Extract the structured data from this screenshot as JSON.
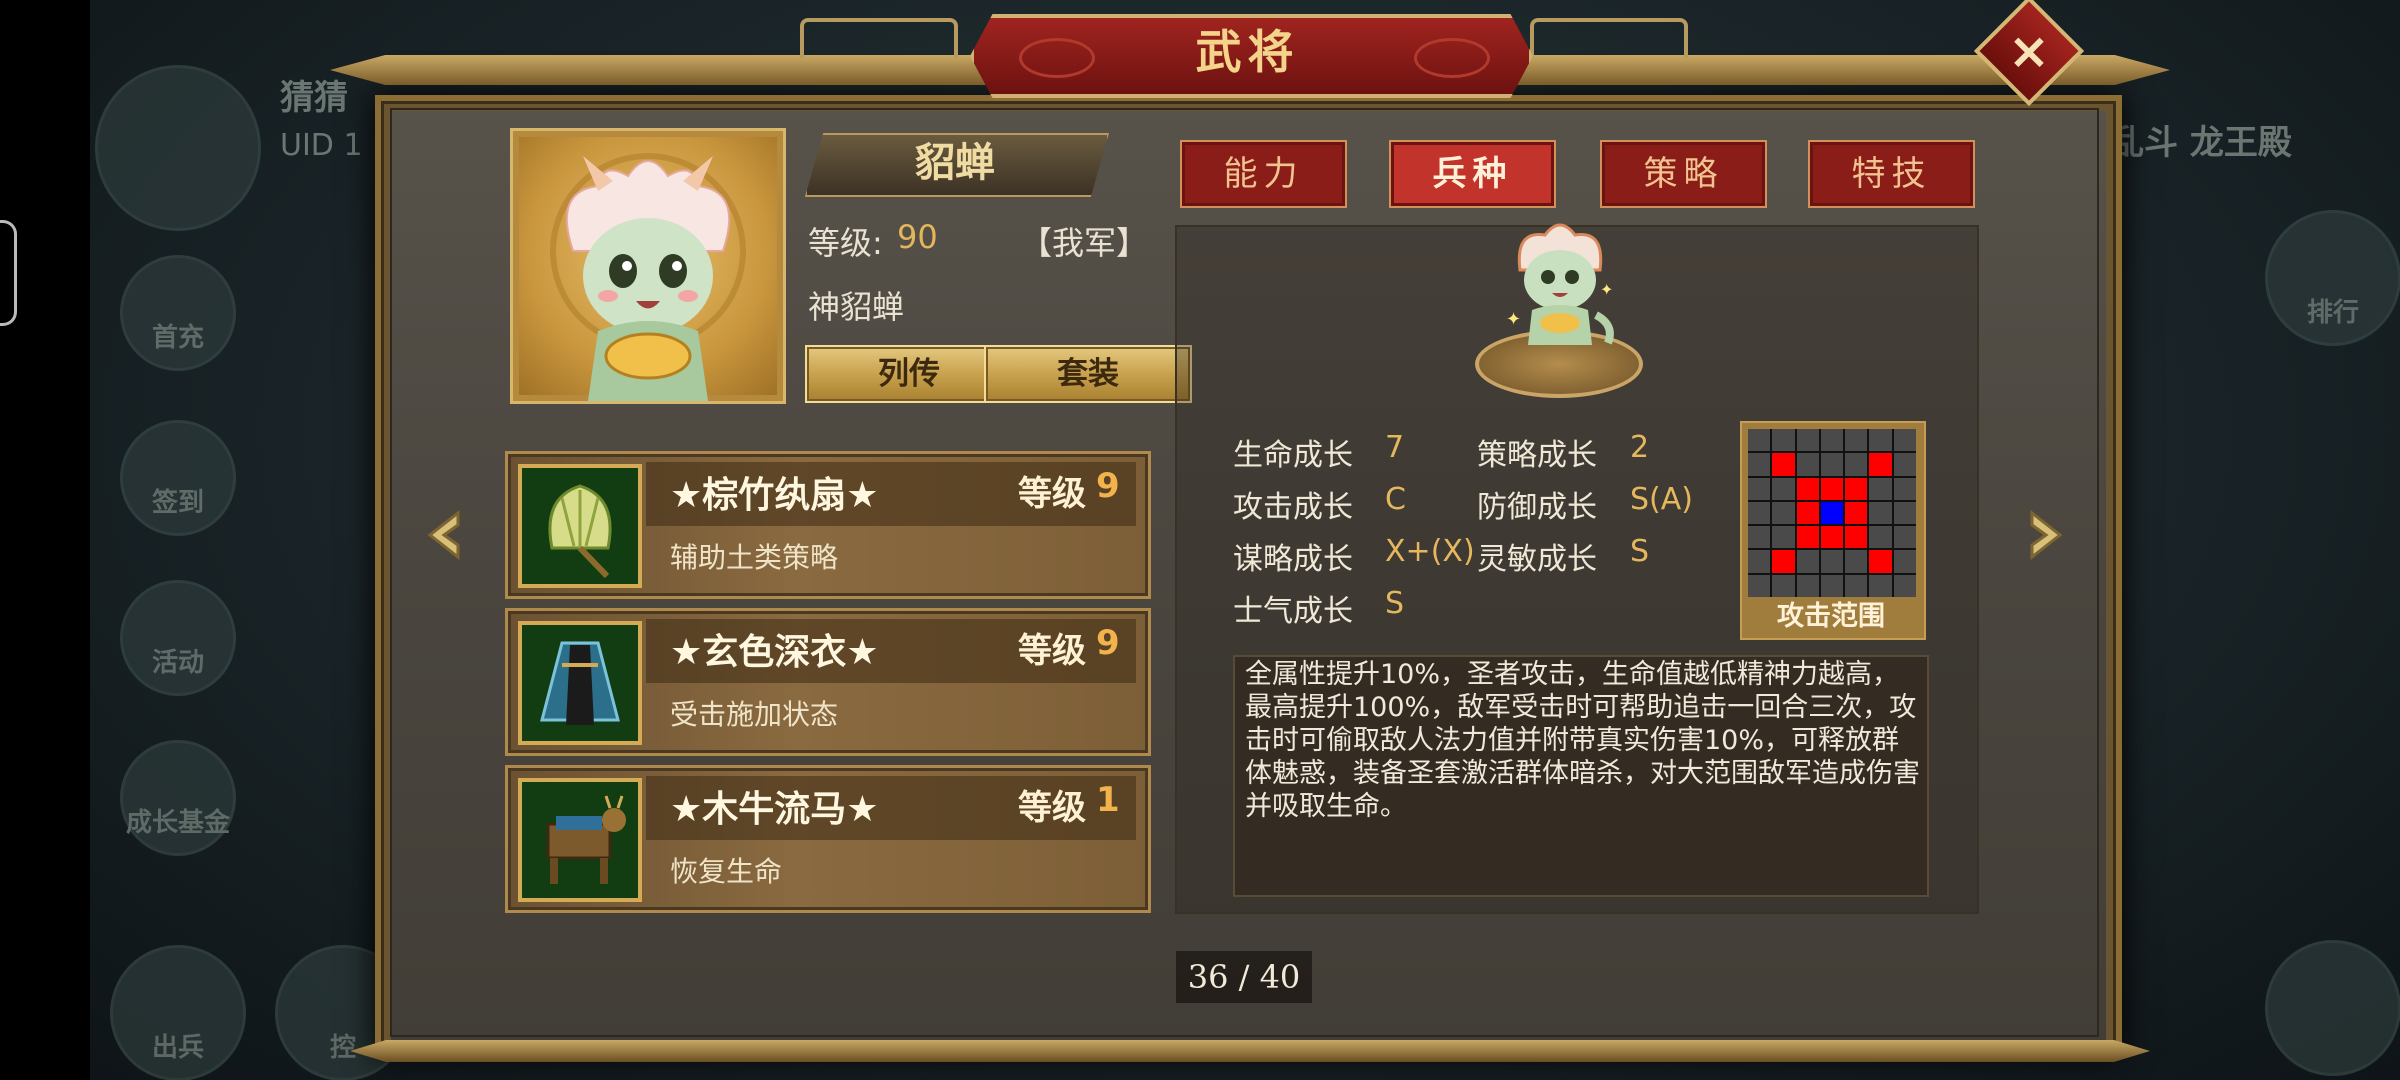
{
  "window": {
    "title": "武将",
    "close_symbol": "×"
  },
  "background": {
    "player_name_partial": "猜猜",
    "uid_partial": "UID  1",
    "server_name_partial": "乱斗  龙王殿",
    "left_menu": [
      "首充",
      "签到",
      "活动",
      "成长基金",
      "出兵",
      "控"
    ],
    "right_menu": [
      "排行"
    ]
  },
  "general": {
    "name": "貂蝉",
    "level_label": "等级:",
    "level_value": "90",
    "faction": "【我军】",
    "title": "神貂蝉",
    "biography_button": "列传",
    "set_button": "套装"
  },
  "tabs": [
    {
      "label": "能力",
      "active": false
    },
    {
      "label": "兵种",
      "active": true
    },
    {
      "label": "策略",
      "active": false
    },
    {
      "label": "特技",
      "active": false
    }
  ],
  "equipment": [
    {
      "name": "★棕竹纨扇★",
      "level_label": "等级",
      "level": "9",
      "description": "辅助土类策略",
      "icon": "palm-fan-icon"
    },
    {
      "name": "★玄色深衣★",
      "level_label": "等级",
      "level": "9",
      "description": "受击施加状态",
      "icon": "dark-robe-icon"
    },
    {
      "name": "★木牛流马★",
      "level_label": "等级",
      "level": "1",
      "description": "恢复生命",
      "icon": "wooden-ox-icon"
    }
  ],
  "stats": {
    "hp_growth_label": "生命成长",
    "hp_growth": "7",
    "strategy_growth_label": "策略成长",
    "strategy_growth": "2",
    "attack_growth_label": "攻击成长",
    "attack_growth": "C",
    "defense_growth_label": "防御成长",
    "defense_growth": "S(A)",
    "tactics_growth_label": "谋略成长",
    "tactics_growth": "X+(X)",
    "agility_growth_label": "灵敏成长",
    "agility_growth": "S",
    "morale_growth_label": "士气成长",
    "morale_growth": "S"
  },
  "attack_range": {
    "label": "攻击范围",
    "grid": [
      "0000000",
      "0r000r0",
      "00rrr00",
      "00rbr00",
      "00rrr00",
      "0r000r0",
      "0000000"
    ]
  },
  "skill_description": "全属性提升10%，圣者攻击，生命值越低精神力越高，最高提升100%，敌军受击时可帮助追击一回合三次，攻击时可偷取敌人法力值并附带真实伤害10%，可释放群体魅惑，装备圣套激活群体暗杀，对大范围敌军造成伤害并吸取生命。",
  "pagination": {
    "text": "36 / 40"
  },
  "colors": {
    "accent_red": "#8b1d19",
    "gold": "#e3b65b",
    "panel": "#4a463f"
  }
}
